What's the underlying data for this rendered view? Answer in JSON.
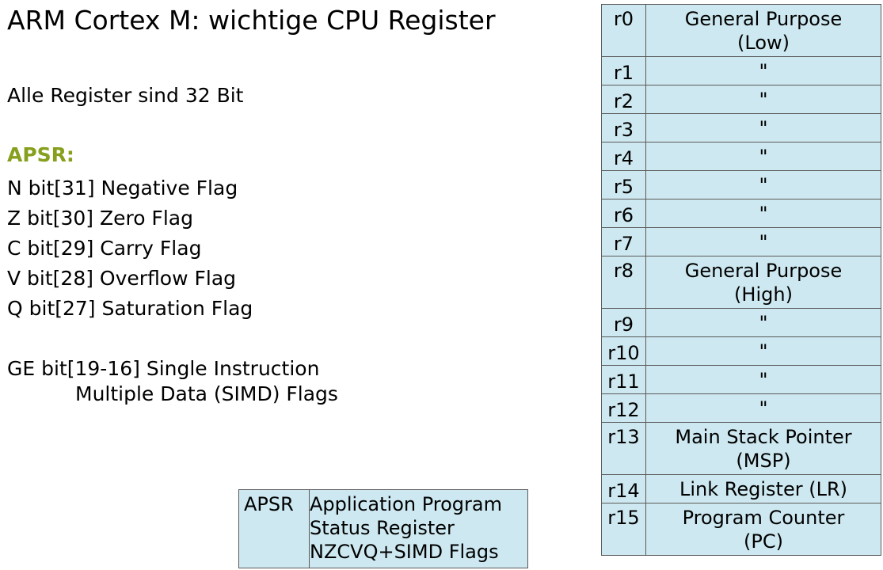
{
  "title": "ARM Cortex M: wichtige CPU Register",
  "intro": "Alle Register sind 32 Bit",
  "apsr_heading": "APSR:",
  "flags": [
    "N bit[31] Negative Flag",
    "Z bit[30] Zero Flag",
    "C bit[29] Carry Flag",
    "V bit[28] Overflow Flag",
    "Q bit[27] Saturation Flag"
  ],
  "ge_flag": {
    "line1": "GE bit[19-16] Single Instruction",
    "line2": "Multiple Data (SIMD) Flags"
  },
  "registers": [
    {
      "name": "r0",
      "desc_line1": "General Purpose",
      "desc_line2": "(Low)"
    },
    {
      "name": "r1",
      "desc_line1": "\"",
      "desc_line2": ""
    },
    {
      "name": "r2",
      "desc_line1": "\"",
      "desc_line2": ""
    },
    {
      "name": "r3",
      "desc_line1": "\"",
      "desc_line2": ""
    },
    {
      "name": "r4",
      "desc_line1": "\"",
      "desc_line2": ""
    },
    {
      "name": "r5",
      "desc_line1": "\"",
      "desc_line2": ""
    },
    {
      "name": "r6",
      "desc_line1": "\"",
      "desc_line2": ""
    },
    {
      "name": "r7",
      "desc_line1": "\"",
      "desc_line2": ""
    },
    {
      "name": "r8",
      "desc_line1": "General Purpose",
      "desc_line2": "(High)"
    },
    {
      "name": "r9",
      "desc_line1": "\"",
      "desc_line2": ""
    },
    {
      "name": "r10",
      "desc_line1": "\"",
      "desc_line2": ""
    },
    {
      "name": "r11",
      "desc_line1": "\"",
      "desc_line2": ""
    },
    {
      "name": "r12",
      "desc_line1": "\"",
      "desc_line2": ""
    },
    {
      "name": "r13",
      "desc_line1": "Main Stack Pointer",
      "desc_line2": "(MSP)"
    },
    {
      "name": "r14",
      "desc_line1": "Link Register (LR)",
      "desc_line2": ""
    },
    {
      "name": "r15",
      "desc_line1": "Program Counter",
      "desc_line2": "(PC)"
    }
  ],
  "apsr_box": {
    "name": "APSR",
    "line1": "Application Program",
    "line2": "Status Register",
    "line3": "NZCVQ+SIMD Flags"
  },
  "colors": {
    "table_fill": "#cde8f0",
    "heading_accent": "#86a01e"
  }
}
